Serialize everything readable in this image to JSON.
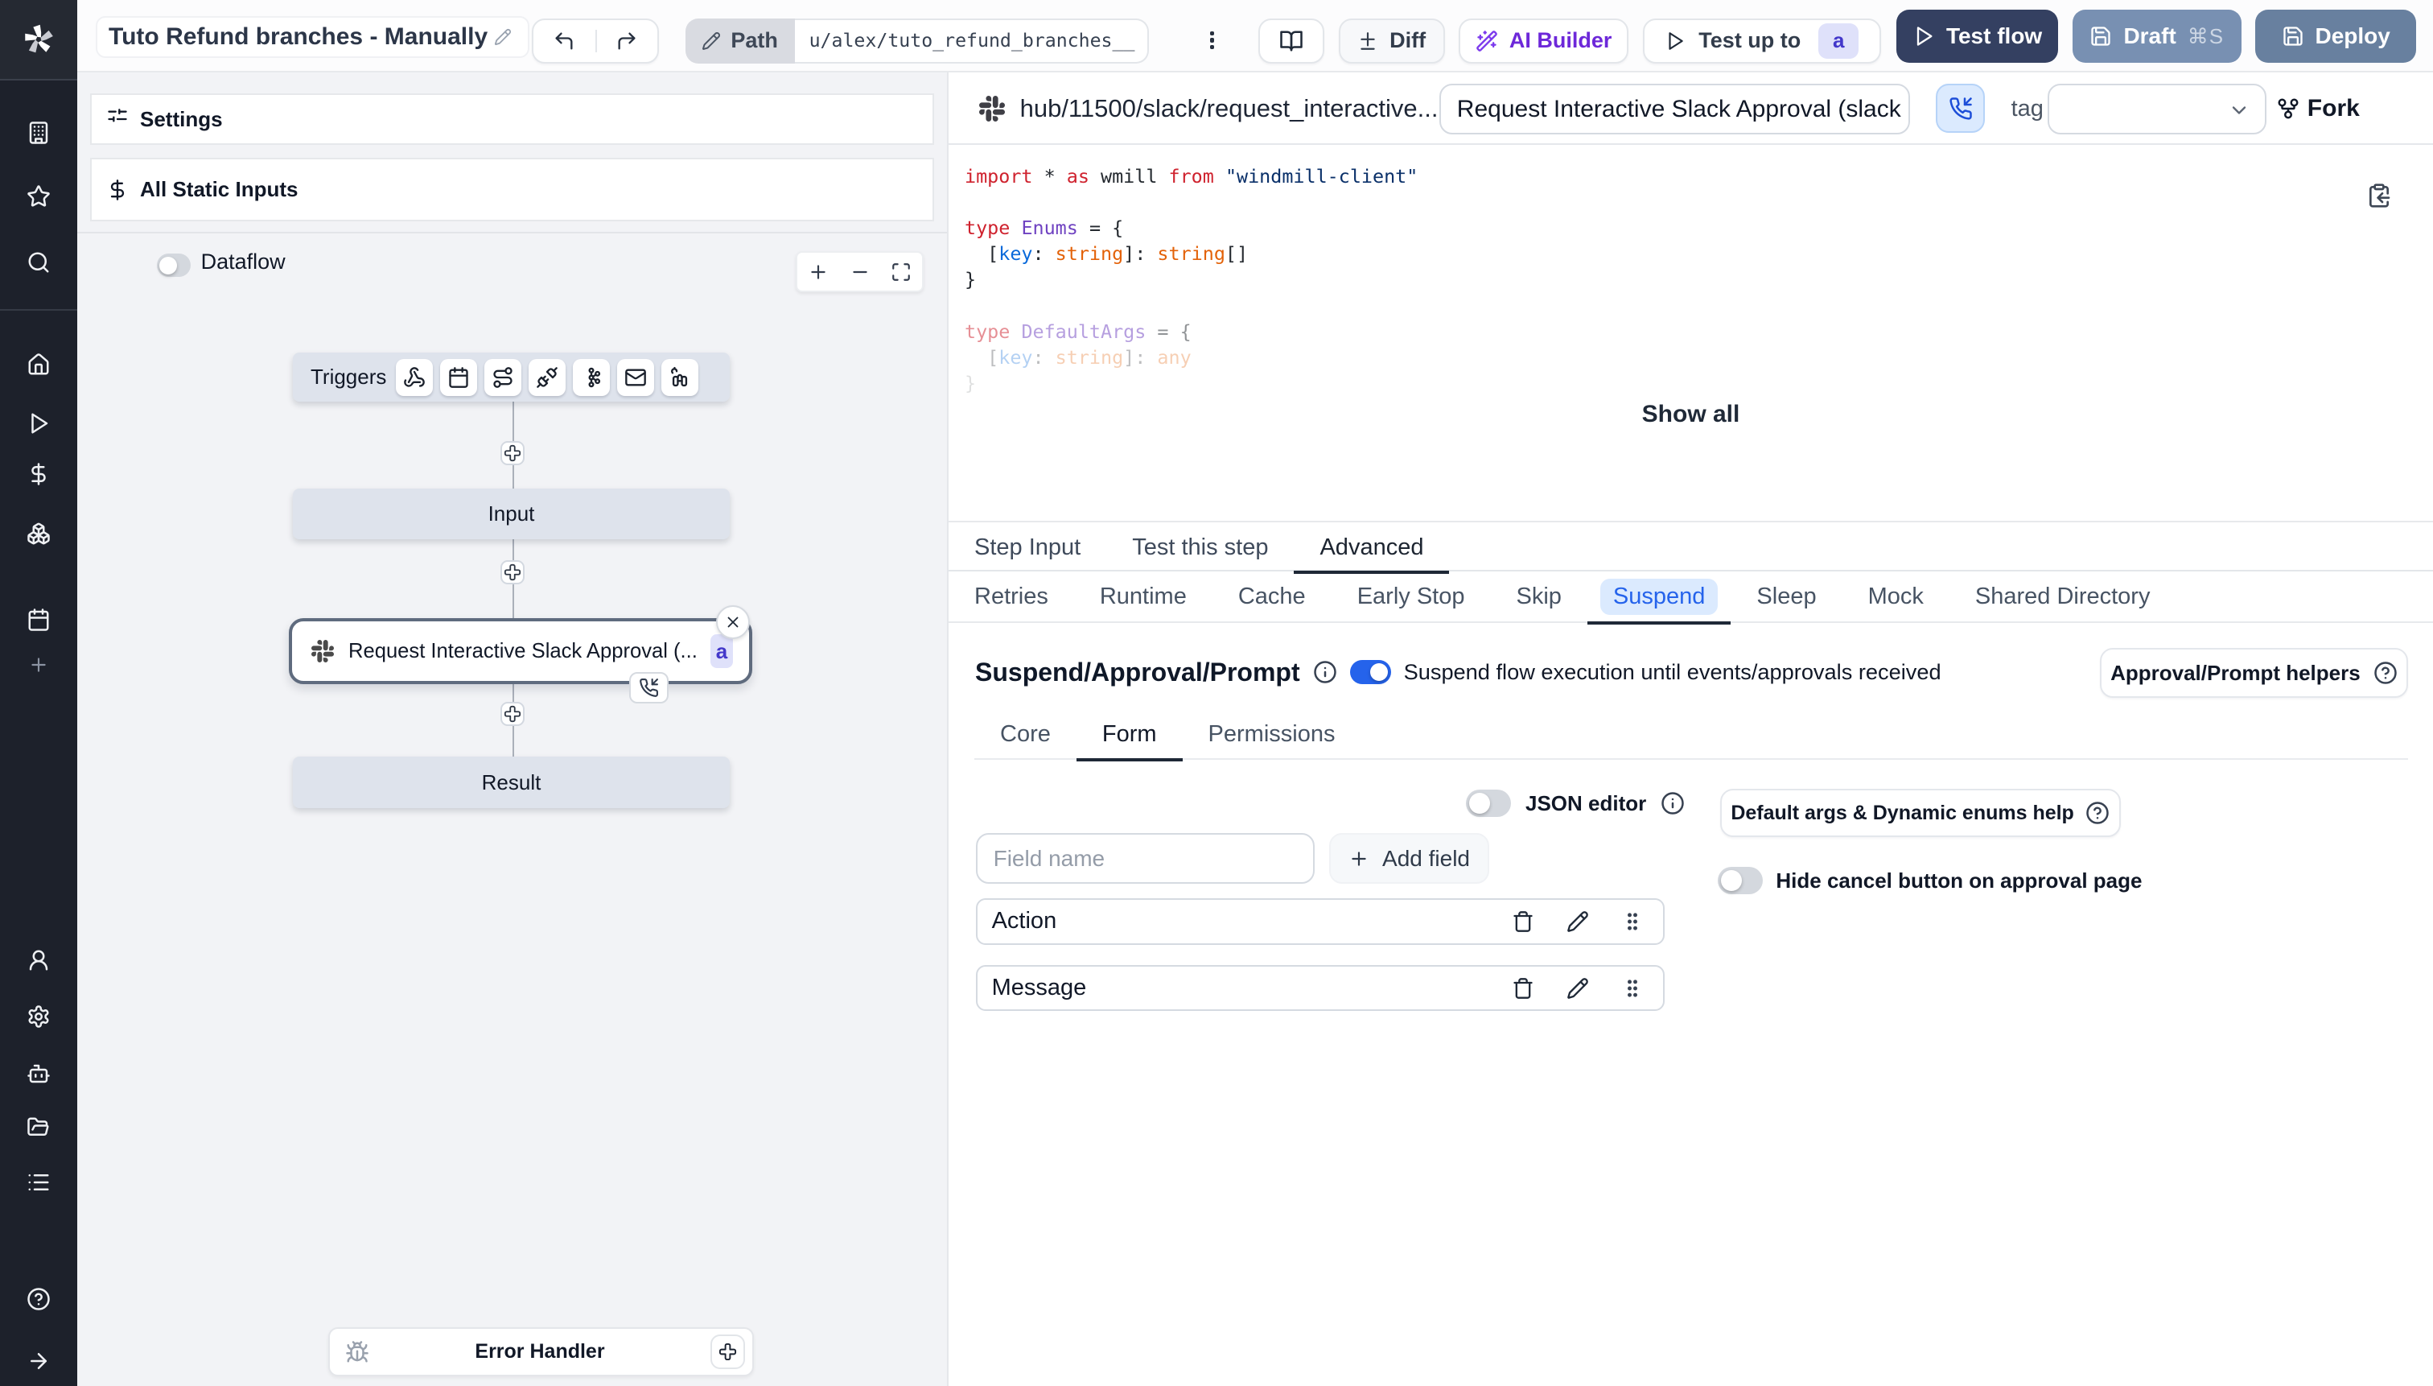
{
  "topbar": {
    "flow_title": "Tuto Refund branches - Manually",
    "path_label": "Path",
    "path_value": "u/alex/tuto_refund_branches__",
    "diff_label": "Diff",
    "ai_builder_label": "AI Builder",
    "test_up_to_label": "Test up to",
    "test_up_to_badge": "a",
    "test_flow_label": "Test flow",
    "draft_label": "Draft",
    "draft_shortcut": "⌘S",
    "deploy_label": "Deploy"
  },
  "left_panel": {
    "settings_label": "Settings",
    "all_static_inputs_label": "All Static Inputs",
    "dataflow_label": "Dataflow",
    "graph": {
      "triggers_label": "Triggers",
      "input_label": "Input",
      "step_label": "Request Interactive Slack Approval (...",
      "step_badge": "a",
      "result_label": "Result",
      "error_handler_label": "Error Handler"
    }
  },
  "right_panel": {
    "hub_path": "hub/11500/slack/request_interactive...",
    "step_title_value": "Request Interactive Slack Approval (slack",
    "tag_label": "tag",
    "fork_label": "Fork",
    "show_all_label": "Show all",
    "tabs": {
      "items": [
        "Step Input",
        "Test this step",
        "Advanced"
      ],
      "active": "Advanced"
    },
    "subtabs": {
      "items": [
        "Retries",
        "Runtime",
        "Cache",
        "Early Stop",
        "Skip",
        "Suspend",
        "Sleep",
        "Mock",
        "Shared Directory"
      ],
      "active": "Suspend"
    },
    "code": {
      "lines": [
        {
          "op": 1,
          "tokens": [
            {
              "t": "import",
              "c": "kw"
            },
            {
              "t": " * ",
              "c": "pl"
            },
            {
              "t": "as",
              "c": "kw"
            },
            {
              "t": " wmill ",
              "c": "pl"
            },
            {
              "t": "from",
              "c": "kw"
            },
            {
              "t": " ",
              "c": "pl"
            },
            {
              "t": "\"windmill-client\"",
              "c": "str"
            }
          ]
        },
        {
          "op": 1,
          "tokens": []
        },
        {
          "op": 1,
          "tokens": [
            {
              "t": "type",
              "c": "kw"
            },
            {
              "t": " ",
              "c": "pl"
            },
            {
              "t": "Enums",
              "c": "type"
            },
            {
              "t": " = {",
              "c": "pl"
            }
          ]
        },
        {
          "op": 1,
          "tokens": [
            {
              "t": "  [",
              "c": "pl"
            },
            {
              "t": "key",
              "c": "prop"
            },
            {
              "t": ": ",
              "c": "pl"
            },
            {
              "t": "string",
              "c": "orange"
            },
            {
              "t": "]: ",
              "c": "pl"
            },
            {
              "t": "string",
              "c": "orange"
            },
            {
              "t": "[]",
              "c": "pl"
            }
          ]
        },
        {
          "op": 1,
          "tokens": [
            {
              "t": "}",
              "c": "pl"
            }
          ]
        },
        {
          "op": 1,
          "tokens": []
        },
        {
          "op": 0.5,
          "tokens": [
            {
              "t": "type",
              "c": "kw"
            },
            {
              "t": " ",
              "c": "pl"
            },
            {
              "t": "DefaultArgs",
              "c": "type"
            },
            {
              "t": " = {",
              "c": "pl"
            }
          ]
        },
        {
          "op": 0.3,
          "tokens": [
            {
              "t": "  [",
              "c": "pl"
            },
            {
              "t": "key",
              "c": "prop"
            },
            {
              "t": ": ",
              "c": "pl"
            },
            {
              "t": "string",
              "c": "orange"
            },
            {
              "t": "]: ",
              "c": "pl"
            },
            {
              "t": "any",
              "c": "orange"
            }
          ]
        },
        {
          "op": 0.14,
          "tokens": [
            {
              "t": "}",
              "c": "pl"
            }
          ]
        }
      ]
    },
    "suspend": {
      "heading": "Suspend/Approval/Prompt",
      "toggle_label": "Suspend flow execution until events/approvals received",
      "helpers_button": "Approval/Prompt helpers",
      "inner_tabs": {
        "items": [
          "Core",
          "Form",
          "Permissions"
        ],
        "active": "Form"
      },
      "form": {
        "json_editor_label": "JSON editor",
        "default_args_help_button": "Default args & Dynamic enums help",
        "field_name_placeholder": "Field name",
        "add_field_label": "Add field",
        "hide_cancel_label": "Hide cancel button on approval page",
        "fields": [
          "Action",
          "Message"
        ]
      }
    }
  },
  "colors": {
    "sidebar_bg": "#1d212b",
    "accent_blue": "#2563eb",
    "ai_purple": "#6d28d9",
    "test_flow_bg": "#344061",
    "draft_bg": "#7890b2",
    "deploy_bg": "#68809f",
    "badge_bg": "#dfe1fa",
    "badge_text": "#4338ca",
    "node_fill": "#dee3ec",
    "code_keyword": "#cf222e",
    "code_string": "#0a3069",
    "code_type": "#6f42c1",
    "code_property": "#0969da",
    "code_builtin": "#e36209"
  }
}
